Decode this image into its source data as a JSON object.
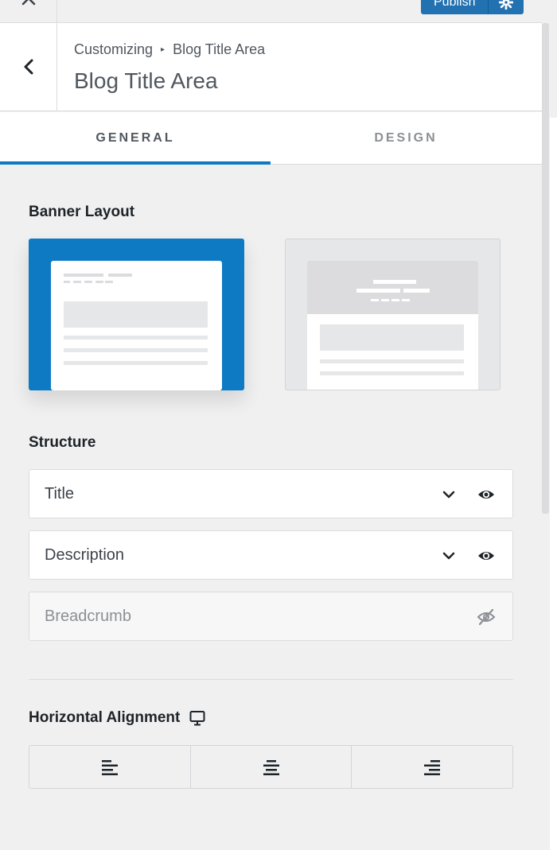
{
  "topbar": {
    "publish_label": "Publish"
  },
  "header": {
    "breadcrumb_root": "Customizing",
    "breadcrumb_current": "Blog Title Area",
    "title": "Blog Title Area"
  },
  "tabs": [
    {
      "label": "GENERAL",
      "active": true
    },
    {
      "label": "DESIGN",
      "active": false
    }
  ],
  "banner_layout": {
    "label": "Banner Layout",
    "options": [
      {
        "name": "inline",
        "selected": true
      },
      {
        "name": "cover",
        "selected": false
      }
    ]
  },
  "structure": {
    "label": "Structure",
    "items": [
      {
        "label": "Title",
        "visible": true
      },
      {
        "label": "Description",
        "visible": true
      },
      {
        "label": "Breadcrumb",
        "visible": false
      }
    ]
  },
  "horizontal_alignment": {
    "label": "Horizontal Alignment",
    "device_icon": "desktop-icon",
    "options": [
      "left",
      "center",
      "right"
    ]
  },
  "colors": {
    "accent": "#0e7ac4",
    "publish": "#2271b1",
    "background": "#f0f0f1"
  }
}
